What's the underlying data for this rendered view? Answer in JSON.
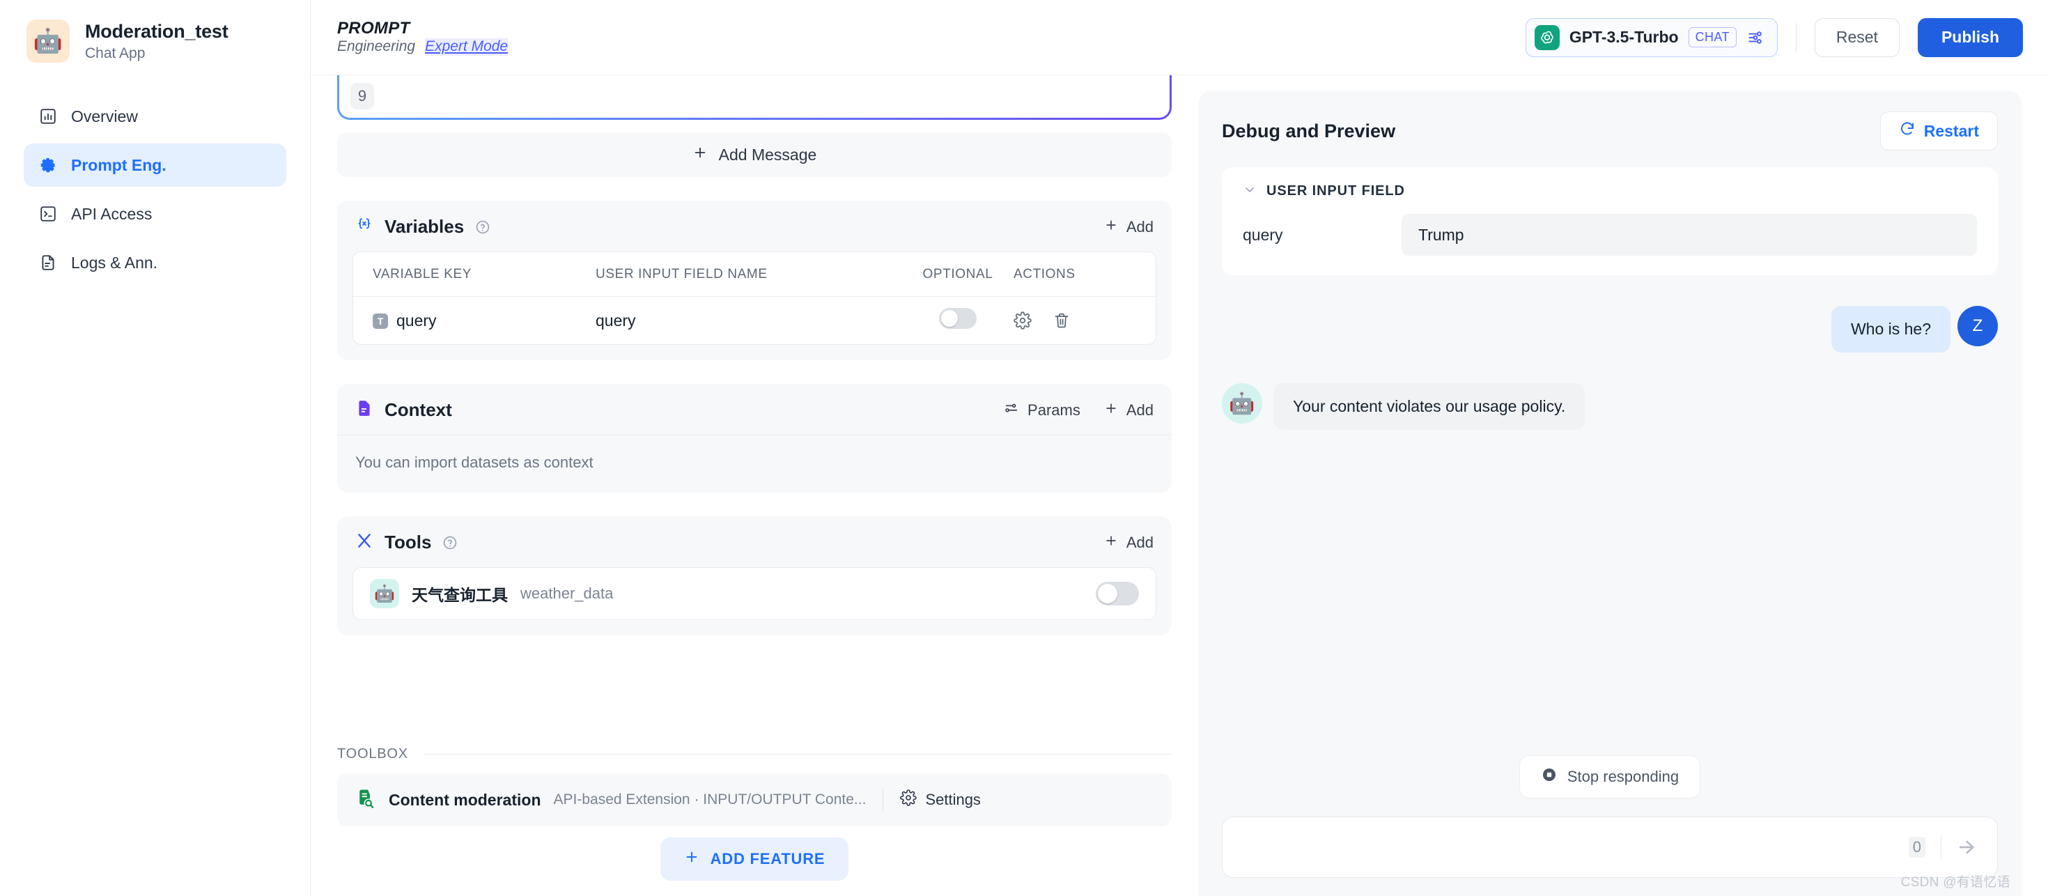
{
  "sidebar": {
    "app_name": "Moderation_test",
    "app_type": "Chat App",
    "app_avatar_icon": "robot-icon",
    "items": [
      {
        "label": "Overview",
        "icon": "chart-bar-icon",
        "active": false
      },
      {
        "label": "Prompt Eng.",
        "icon": "gear-icon",
        "active": true
      },
      {
        "label": "API Access",
        "icon": "terminal-icon",
        "active": false
      },
      {
        "label": "Logs & Ann.",
        "icon": "document-icon",
        "active": false
      }
    ]
  },
  "topbar": {
    "brand_line1": "PROMPT",
    "brand_line2": "Engineering",
    "expert_mode_link": "Expert Mode",
    "model": {
      "icon": "openai-icon",
      "name": "GPT-3.5-Turbo",
      "badge": "CHAT",
      "settings_icon": "sliders-icon"
    },
    "reset_label": "Reset",
    "publish_label": "Publish"
  },
  "prompt": {
    "badge_value": "9",
    "add_message_label": "Add Message",
    "add_message_icon": "plus-icon"
  },
  "variables": {
    "title": "Variables",
    "help_icon": "question-circle-icon",
    "add_label": "Add",
    "add_icon": "plus-icon",
    "icon": "braces-x-icon",
    "columns": [
      "VARIABLE KEY",
      "USER INPUT FIELD NAME",
      "OPTIONAL",
      "ACTIONS"
    ],
    "rows": [
      {
        "type_chip": "T",
        "key": "query",
        "field_name": "query",
        "optional": false,
        "actions": [
          "gear-icon",
          "trash-icon"
        ]
      }
    ]
  },
  "context": {
    "title": "Context",
    "icon": "document-blue-icon",
    "params_label": "Params",
    "params_icon": "sliders-icon",
    "add_label": "Add",
    "add_icon": "plus-icon",
    "empty_note": "You can import datasets as context"
  },
  "tools": {
    "title": "Tools",
    "help_icon": "question-circle-icon",
    "icon": "tools-icon",
    "add_label": "Add",
    "add_icon": "plus-icon",
    "items": [
      {
        "avatar_icon": "robot-icon",
        "name": "天气查询工具",
        "key": "weather_data",
        "enabled": false
      }
    ]
  },
  "toolbox": {
    "label": "TOOLBOX",
    "extensions": [
      {
        "icon": "moderation-icon",
        "name": "Content moderation",
        "description": "API-based Extension · INPUT/OUTPUT Conte...",
        "settings_label": "Settings",
        "settings_icon": "gear-icon"
      }
    ],
    "add_feature_label": "ADD FEATURE",
    "add_feature_icon": "plus-icon"
  },
  "debug": {
    "title": "Debug and Preview",
    "restart_label": "Restart",
    "restart_icon": "refresh-icon",
    "user_input_field": {
      "label": "USER INPUT FIELD",
      "chevron_icon": "chevron-down-icon",
      "fields": [
        {
          "key": "query",
          "value": "Trump",
          "placeholder": ""
        }
      ]
    },
    "messages": [
      {
        "role": "user",
        "text": "Who is he?",
        "avatar": "Z"
      },
      {
        "role": "assistant",
        "text": "Your content violates our usage policy.",
        "avatar_icon": "robot-icon"
      }
    ],
    "stop_label": "Stop responding",
    "stop_icon": "stop-square-icon",
    "composer": {
      "value": "",
      "placeholder": "",
      "counter": "0",
      "send_icon": "send-icon"
    }
  },
  "watermark": "CSDN @有语忆语",
  "colors": {
    "accent": "#1e6fff",
    "publish": "#1f5fe0",
    "active_nav_bg": "#e4efff",
    "openai_green": "#10a37f",
    "moderation_green": "#12924f",
    "gradient_from": "#5aa2f7",
    "gradient_to": "#6b4bf0"
  }
}
